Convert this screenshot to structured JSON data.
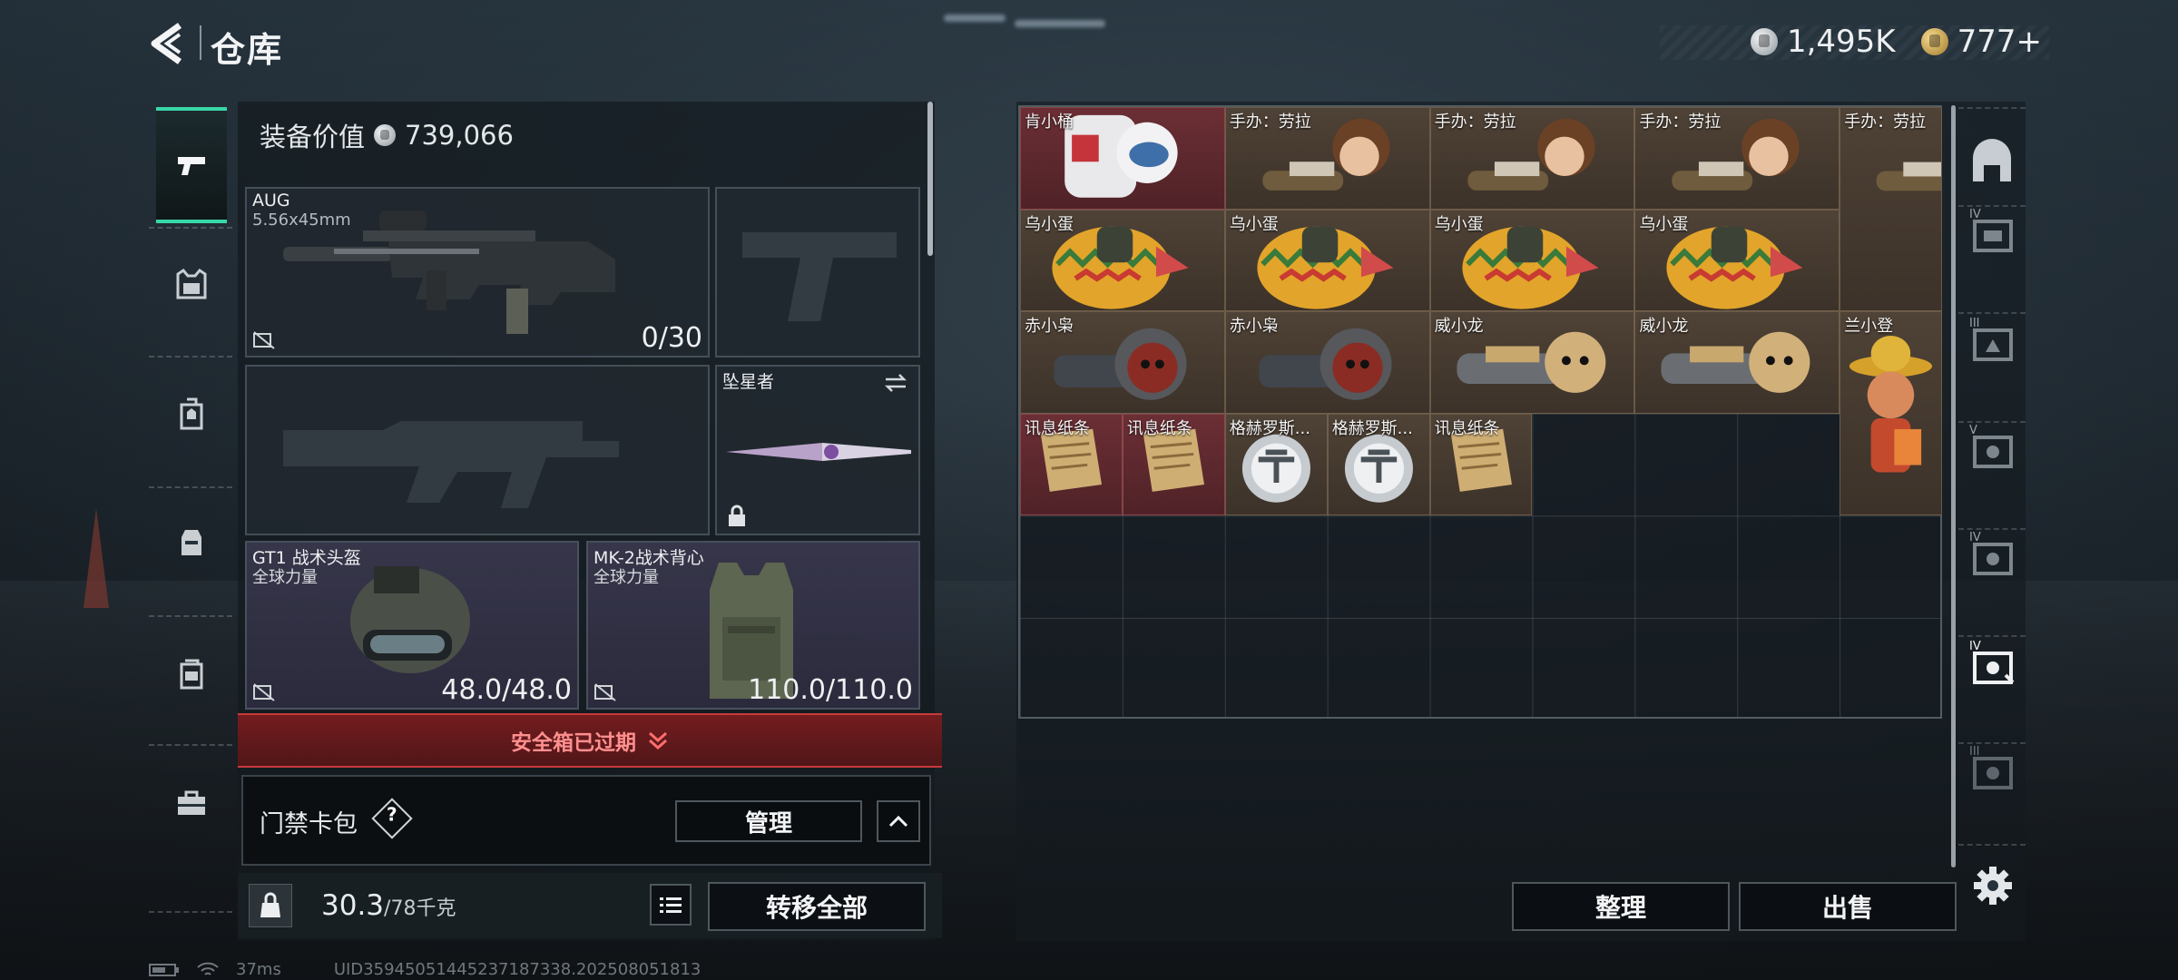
{
  "header": {
    "title": "仓库",
    "currencies": [
      {
        "icon": "silver-coin-icon",
        "value": "1,495K"
      },
      {
        "icon": "gold-coin-icon",
        "value": "777+"
      }
    ]
  },
  "loadout": {
    "equip_value_label": "装备价值",
    "equip_value": "739,066",
    "primary_weapon": {
      "name": "AUG",
      "caliber": "5.56x45mm",
      "ammo": "0/30"
    },
    "melee": {
      "name": "坠星者"
    },
    "helmet": {
      "name": "GT1 战术头盔",
      "faction": "全球力量",
      "durability": "48.0/48.0"
    },
    "vest": {
      "name": "MK-2战术背心",
      "faction": "全球力量",
      "durability": "110.0/110.0"
    },
    "safebox_status": "安全箱已过期",
    "keycard_label": "门禁卡包",
    "help_mark": "?",
    "manage_label": "管理",
    "weight_value": "30.3",
    "weight_capacity": "/78千克",
    "transfer_all_label": "转移全部"
  },
  "storage": {
    "items": [
      {
        "label": "肯小桶",
        "tone": "red"
      },
      {
        "label": "手办：劳拉",
        "tone": "brown"
      },
      {
        "label": "手办：劳拉",
        "tone": "brown"
      },
      {
        "label": "手办：劳拉",
        "tone": "brown"
      },
      {
        "label": "手办：劳拉",
        "tone": "brown"
      },
      {
        "label": "乌小蛋",
        "tone": "brown"
      },
      {
        "label": "乌小蛋",
        "tone": "brown"
      },
      {
        "label": "乌小蛋",
        "tone": "brown"
      },
      {
        "label": "乌小蛋",
        "tone": "brown"
      },
      {
        "label": "赤小枭",
        "tone": "brown"
      },
      {
        "label": "赤小枭",
        "tone": "brown"
      },
      {
        "label": "威小龙",
        "tone": "brown"
      },
      {
        "label": "威小龙",
        "tone": "brown"
      },
      {
        "label": "兰小登",
        "tone": "brown"
      },
      {
        "label": "讯息纸条",
        "tone": "red"
      },
      {
        "label": "讯息纸条",
        "tone": "red"
      },
      {
        "label": "格赫罗斯...",
        "tone": "brown"
      },
      {
        "label": "格赫罗斯...",
        "tone": "brown"
      },
      {
        "label": "讯息纸条",
        "tone": "brown"
      }
    ],
    "sort_label": "整理",
    "sell_label": "出售"
  },
  "right_nav": {
    "tabs": [
      "storage-home-icon",
      "IV",
      "III",
      "V",
      "IV",
      "IV",
      "III"
    ]
  },
  "status_bar": {
    "ping": "37ms",
    "uid": "UID35945051445237187338.202508051813"
  },
  "colors": {
    "accent": "#39d7a8",
    "alert": "#c63a3c",
    "item_brown": "#4f4236",
    "item_red": "#6b2f35"
  }
}
